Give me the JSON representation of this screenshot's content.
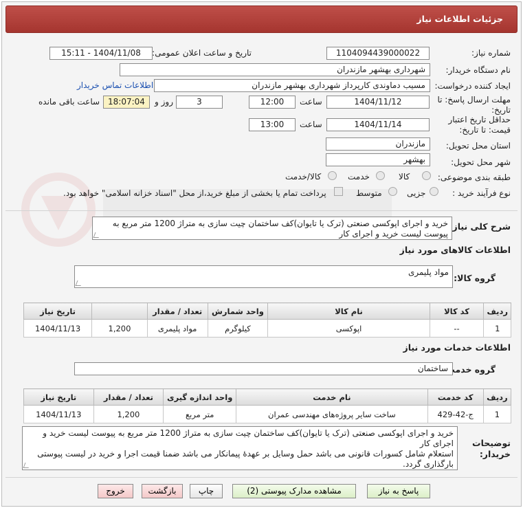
{
  "header": {
    "title": "جزئیات اطلاعات نیاز"
  },
  "form": {
    "need_number_label": "شماره نیاز:",
    "need_number": "1104094439000022",
    "announce_label": "تاریخ و ساعت اعلان عمومی:",
    "announce_value": "1404/11/08 - 15:11",
    "buyer_label": "نام دستگاه خریدار:",
    "buyer_value": "شهرداری بهشهر مازندران",
    "creator_label": "ایجاد کننده درخواست:",
    "creator_value": "مسیب دماوندی کارپرداز شهرداری بهشهر مازندران",
    "contact_link": "اطلاعات تماس خریدار",
    "deadline_label_1": "مهلت ارسال پاسخ: تا",
    "deadline_label_2": "تاریخ:",
    "deadline_date": "1404/11/12",
    "time_label": "ساعت",
    "deadline_time": "12:00",
    "days_value": "3",
    "days_label": "روز و",
    "remaining_value": "18:07:04",
    "remaining_label": "ساعت باقی مانده",
    "validity_label_1": "حداقل تاریخ اعتبار",
    "validity_label_2": "قیمت: تا تاریخ:",
    "validity_date": "1404/11/14",
    "validity_time": "13:00",
    "province_label": "استان محل تحویل:",
    "province_value": "مازندران",
    "city_label": "شهر محل تحویل:",
    "city_value": "بهشهر",
    "category_label": "طبقه بندی موضوعی:",
    "category_options": [
      "کالا",
      "خدمت",
      "کالا/خدمت"
    ],
    "process_label": "نوع فرآیند خرید :",
    "process_options": [
      "جزیی",
      "متوسط"
    ],
    "treasury_text": "پرداخت تمام یا بخشی از مبلغ خرید،از محل \"اسناد خزانه اسلامی\" خواهد بود."
  },
  "general_desc": {
    "label": "شرح کلی نیاز:",
    "text": "خرید و اجرای اپوکسی صنعتی (ترک یا تایوان)کف ساختمان چیت سازی به متراژ 1200 متر مربع به پیوست لیست خرید و اجرای کار"
  },
  "goods": {
    "section_title": "اطلاعات کالاهای مورد نیاز",
    "group_label": "گروه کالا:",
    "group_value": "مواد پلیمری",
    "columns": [
      "ردیف",
      "کد کالا",
      "نام کالا",
      "واحد شمارش",
      "تعداد / مقدار",
      "تاریخ نیاز"
    ],
    "rows": [
      {
        "row": "1",
        "code": "--",
        "name": "اپوکسی",
        "unit": "کیلوگرم",
        "qty_unit": "مواد پلیمری",
        "qty": "1,200",
        "date": "1404/11/13"
      }
    ]
  },
  "services": {
    "section_title": "اطلاعات خدمات مورد نیاز",
    "group_label": "گروه خدمت:",
    "group_value": "ساختمان",
    "columns": [
      "ردیف",
      "کد خدمت",
      "نام خدمت",
      "واحد اندازه گیری",
      "تعداد / مقدار",
      "تاریخ نیاز"
    ],
    "rows": [
      {
        "row": "1",
        "code": "ج-42-429",
        "name": "ساخت سایر پروژه‌های مهندسی عمران",
        "unit": "متر مربع",
        "qty": "1,200",
        "date": "1404/11/13"
      }
    ]
  },
  "buyer_notes": {
    "label_1": "توضیحات",
    "label_2": "خریدار:",
    "line_1": "خرید و اجرای اپوکسی صنعتی (ترک یا تایوان)کف ساختمان چیت سازی به متراژ 1200 متر مربع به پیوست لیست خرید و اجرای کار",
    "line_2": "استعلام شامل کسورات قانونی می باشد حمل وسایل بر عهدۀ پیمانکار می باشد ضمنا قیمت اجرا و خرید در لیست پیوستی بارگذاری گردد."
  },
  "buttons": {
    "reply": "پاسخ به نیاز",
    "attachments": "مشاهده مدارک پیوستی (2)",
    "print": "چاپ",
    "back": "بازگشت",
    "exit": "خروج"
  },
  "colors": {
    "header": "#b0403a",
    "link": "#1a4fb0",
    "highlight": "#fbf3c3"
  }
}
